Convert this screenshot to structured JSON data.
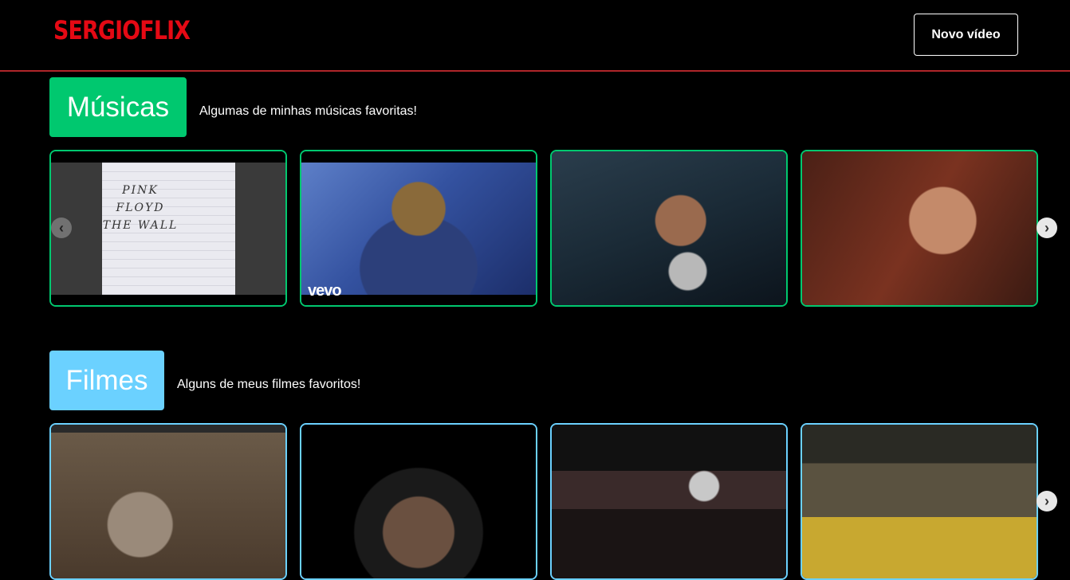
{
  "header": {
    "logo": "SERGIOFLIX",
    "new_video_label": "Novo vídeo"
  },
  "categories": [
    {
      "title": "Músicas",
      "description": "Algumas de minhas músicas favoritas!",
      "color": "#00c86f",
      "videos": [
        {
          "name": "pink-floyd-the-wall",
          "album_text": "PINK FLOYD THE WALL"
        },
        {
          "name": "concert-singer-hat",
          "overlay": "vevo"
        },
        {
          "name": "singer-microphone-close"
        },
        {
          "name": "singer-live-performance"
        }
      ]
    },
    {
      "title": "Filmes",
      "description": "Alguns de meus filmes favoritos!",
      "color": "#6bd1ff",
      "videos": [
        {
          "name": "gladiator-arena"
        },
        {
          "name": "astronaut-helmet"
        },
        {
          "name": "basketball-dunk"
        },
        {
          "name": "baseball-team"
        }
      ]
    }
  ],
  "icons": {
    "arrow_left": "chevron-left-icon",
    "arrow_right": "chevron-right-icon"
  }
}
